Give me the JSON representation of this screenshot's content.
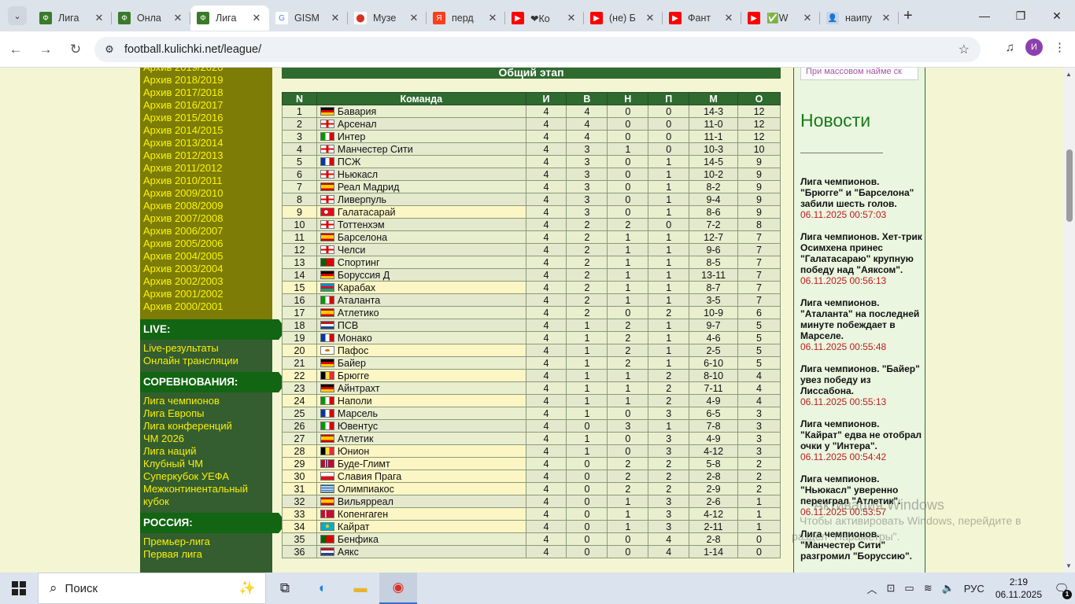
{
  "browser": {
    "tabs": [
      {
        "title": "Лига",
        "icon": "football-site-icon",
        "fav_bg": "#3a7a2a",
        "fav_char": "Ф"
      },
      {
        "title": "Онла",
        "icon": "football-site-icon",
        "fav_bg": "#3a7a2a",
        "fav_char": "Ф"
      },
      {
        "title": "Лига",
        "icon": "football-site-icon",
        "fav_bg": "#3a7a2a",
        "fav_char": "Ф",
        "active": true
      },
      {
        "title": "GISM",
        "icon": "google-icon",
        "fav_bg": "#ffffff",
        "fav_char": "G"
      },
      {
        "title": "Музе",
        "icon": "maps-pin-icon",
        "fav_bg": "#ffffff",
        "fav_char": "⬤"
      },
      {
        "title": "перд",
        "icon": "yandex-icon",
        "fav_bg": "#fc3f1d",
        "fav_char": "Я"
      },
      {
        "title": "❤Ко",
        "icon": "youtube-icon",
        "fav_bg": "#ff0000",
        "fav_char": "▶"
      },
      {
        "title": "(не) Б",
        "icon": "youtube-icon",
        "fav_bg": "#ff0000",
        "fav_char": "▶"
      },
      {
        "title": "Фант",
        "icon": "youtube-icon",
        "fav_bg": "#ff0000",
        "fav_char": "▶"
      },
      {
        "title": "✅W",
        "icon": "youtube-icon",
        "fav_bg": "#ff0000",
        "fav_char": "▶"
      },
      {
        "title": "наипу",
        "icon": "person-icon",
        "fav_bg": "#c8d4e8",
        "fav_char": "👤"
      }
    ],
    "url": "football.kulichki.net/league/",
    "avatar_letter": "И"
  },
  "sidebar": {
    "archive": [
      "Архив 2019/2020",
      "Архив 2018/2019",
      "Архив 2017/2018",
      "Архив 2016/2017",
      "Архив 2015/2016",
      "Архив 2014/2015",
      "Архив 2013/2014",
      "Архив 2012/2013",
      "Архив 2011/2012",
      "Архив 2010/2011",
      "Архив 2009/2010",
      "Архив 2008/2009",
      "Архив 2007/2008",
      "Архив 2006/2007",
      "Архив 2005/2006",
      "Архив 2004/2005",
      "Архив 2003/2004",
      "Архив 2002/2003",
      "Архив 2001/2002",
      "Архив 2000/2001"
    ],
    "live_title": "LIVE:",
    "live_links": [
      "Live-результаты",
      "Онлайн трансляции"
    ],
    "comp_title": "СОРЕВНОВАНИЯ:",
    "comp_links": [
      "Лига чемпионов",
      "Лига Европы",
      "Лига конференций",
      "ЧМ 2026",
      "Лига наций",
      "Клубный ЧМ",
      "Суперкубок УЕФА",
      "Межконтинентальный кубок"
    ],
    "russia_title": "РОССИЯ:",
    "russia_links": [
      "Премьер-лига",
      "Первая лига"
    ]
  },
  "standings": {
    "stage_title": "Общий этап",
    "headers": [
      "N",
      "Команда",
      "И",
      "В",
      "Н",
      "П",
      "М",
      "О"
    ],
    "rows": [
      {
        "n": "1",
        "team": "Бавария",
        "flag": "de",
        "p": "4",
        "w": "4",
        "d": "0",
        "l": "0",
        "goals": "14-3",
        "pts": "12"
      },
      {
        "n": "2",
        "team": "Арсенал",
        "flag": "en",
        "p": "4",
        "w": "4",
        "d": "0",
        "l": "0",
        "goals": "11-0",
        "pts": "12"
      },
      {
        "n": "3",
        "team": "Интер",
        "flag": "it",
        "p": "4",
        "w": "4",
        "d": "0",
        "l": "0",
        "goals": "11-1",
        "pts": "12"
      },
      {
        "n": "4",
        "team": "Манчестер Сити",
        "flag": "en",
        "p": "4",
        "w": "3",
        "d": "1",
        "l": "0",
        "goals": "10-3",
        "pts": "10"
      },
      {
        "n": "5",
        "team": "ПСЖ",
        "flag": "fr",
        "p": "4",
        "w": "3",
        "d": "0",
        "l": "1",
        "goals": "14-5",
        "pts": "9"
      },
      {
        "n": "6",
        "team": "Ньюкасл",
        "flag": "en",
        "p": "4",
        "w": "3",
        "d": "0",
        "l": "1",
        "goals": "10-2",
        "pts": "9"
      },
      {
        "n": "7",
        "team": "Реал Мадрид",
        "flag": "es",
        "p": "4",
        "w": "3",
        "d": "0",
        "l": "1",
        "goals": "8-2",
        "pts": "9"
      },
      {
        "n": "8",
        "team": "Ливерпуль",
        "flag": "en",
        "p": "4",
        "w": "3",
        "d": "0",
        "l": "1",
        "goals": "9-4",
        "pts": "9"
      },
      {
        "n": "9",
        "team": "Галатасарай",
        "flag": "tr",
        "p": "4",
        "w": "3",
        "d": "0",
        "l": "1",
        "goals": "8-6",
        "pts": "9",
        "hl": true
      },
      {
        "n": "10",
        "team": "Тоттенхэм",
        "flag": "en",
        "p": "4",
        "w": "2",
        "d": "2",
        "l": "0",
        "goals": "7-2",
        "pts": "8"
      },
      {
        "n": "11",
        "team": "Барселона",
        "flag": "es",
        "p": "4",
        "w": "2",
        "d": "1",
        "l": "1",
        "goals": "12-7",
        "pts": "7"
      },
      {
        "n": "12",
        "team": "Челси",
        "flag": "en",
        "p": "4",
        "w": "2",
        "d": "1",
        "l": "1",
        "goals": "9-6",
        "pts": "7"
      },
      {
        "n": "13",
        "team": "Спортинг",
        "flag": "pt",
        "p": "4",
        "w": "2",
        "d": "1",
        "l": "1",
        "goals": "8-5",
        "pts": "7"
      },
      {
        "n": "14",
        "team": "Боруссия Д",
        "flag": "de",
        "p": "4",
        "w": "2",
        "d": "1",
        "l": "1",
        "goals": "13-11",
        "pts": "7"
      },
      {
        "n": "15",
        "team": "Карабах",
        "flag": "az",
        "p": "4",
        "w": "2",
        "d": "1",
        "l": "1",
        "goals": "8-7",
        "pts": "7",
        "hl": true
      },
      {
        "n": "16",
        "team": "Аталанта",
        "flag": "it",
        "p": "4",
        "w": "2",
        "d": "1",
        "l": "1",
        "goals": "3-5",
        "pts": "7"
      },
      {
        "n": "17",
        "team": "Атлетико",
        "flag": "es",
        "p": "4",
        "w": "2",
        "d": "0",
        "l": "2",
        "goals": "10-9",
        "pts": "6"
      },
      {
        "n": "18",
        "team": "ПСВ",
        "flag": "nl",
        "p": "4",
        "w": "1",
        "d": "2",
        "l": "1",
        "goals": "9-7",
        "pts": "5"
      },
      {
        "n": "19",
        "team": "Монако",
        "flag": "fr",
        "p": "4",
        "w": "1",
        "d": "2",
        "l": "1",
        "goals": "4-6",
        "pts": "5"
      },
      {
        "n": "20",
        "team": "Пафос",
        "flag": "cy",
        "p": "4",
        "w": "1",
        "d": "2",
        "l": "1",
        "goals": "2-5",
        "pts": "5",
        "hl": true
      },
      {
        "n": "21",
        "team": "Байер",
        "flag": "de",
        "p": "4",
        "w": "1",
        "d": "2",
        "l": "1",
        "goals": "6-10",
        "pts": "5"
      },
      {
        "n": "22",
        "team": "Брюгге",
        "flag": "be",
        "p": "4",
        "w": "1",
        "d": "1",
        "l": "2",
        "goals": "8-10",
        "pts": "4",
        "hl": true
      },
      {
        "n": "23",
        "team": "Айнтрахт",
        "flag": "de",
        "p": "4",
        "w": "1",
        "d": "1",
        "l": "2",
        "goals": "7-11",
        "pts": "4"
      },
      {
        "n": "24",
        "team": "Наполи",
        "flag": "it",
        "p": "4",
        "w": "1",
        "d": "1",
        "l": "2",
        "goals": "4-9",
        "pts": "4",
        "hl": true
      },
      {
        "n": "25",
        "team": "Марсель",
        "flag": "fr",
        "p": "4",
        "w": "1",
        "d": "0",
        "l": "3",
        "goals": "6-5",
        "pts": "3"
      },
      {
        "n": "26",
        "team": "Ювентус",
        "flag": "it",
        "p": "4",
        "w": "0",
        "d": "3",
        "l": "1",
        "goals": "7-8",
        "pts": "3"
      },
      {
        "n": "27",
        "team": "Атлетик",
        "flag": "es",
        "p": "4",
        "w": "1",
        "d": "0",
        "l": "3",
        "goals": "4-9",
        "pts": "3"
      },
      {
        "n": "28",
        "team": "Юнион",
        "flag": "be",
        "p": "4",
        "w": "1",
        "d": "0",
        "l": "3",
        "goals": "4-12",
        "pts": "3",
        "hl": true
      },
      {
        "n": "29",
        "team": "Буде-Глимт",
        "flag": "no",
        "p": "4",
        "w": "0",
        "d": "2",
        "l": "2",
        "goals": "5-8",
        "pts": "2",
        "hl": true
      },
      {
        "n": "30",
        "team": "Славия Прага",
        "flag": "cz",
        "p": "4",
        "w": "0",
        "d": "2",
        "l": "2",
        "goals": "2-8",
        "pts": "2",
        "hl": true
      },
      {
        "n": "31",
        "team": "Олимпиакос",
        "flag": "gr",
        "p": "4",
        "w": "0",
        "d": "2",
        "l": "2",
        "goals": "2-9",
        "pts": "2",
        "hl": true
      },
      {
        "n": "32",
        "team": "Вильярреал",
        "flag": "es",
        "p": "4",
        "w": "0",
        "d": "1",
        "l": "3",
        "goals": "2-6",
        "pts": "1"
      },
      {
        "n": "33",
        "team": "Копенгаген",
        "flag": "dk",
        "p": "4",
        "w": "0",
        "d": "1",
        "l": "3",
        "goals": "4-12",
        "pts": "1",
        "hl": true
      },
      {
        "n": "34",
        "team": "Кайрат",
        "flag": "kz",
        "p": "4",
        "w": "0",
        "d": "1",
        "l": "3",
        "goals": "2-11",
        "pts": "1",
        "hl": true
      },
      {
        "n": "35",
        "team": "Бенфика",
        "flag": "pt",
        "p": "4",
        "w": "0",
        "d": "0",
        "l": "4",
        "goals": "2-8",
        "pts": "0"
      },
      {
        "n": "36",
        "team": "Аякс",
        "flag": "nl",
        "p": "4",
        "w": "0",
        "d": "0",
        "l": "4",
        "goals": "1-14",
        "pts": "0"
      }
    ]
  },
  "news": {
    "ad_text": "При массовом найме ск",
    "title": "Новости",
    "items": [
      {
        "title": "Лига чемпионов. \"Брюгге\" и \"Барселона\" забили шесть голов.",
        "time": "06.11.2025 00:57:03"
      },
      {
        "title": "Лига чемпионов. Хет-трик Осимхена принес \"Галатасараю\" крупную победу над \"Аяксом\".",
        "time": "06.11.2025 00:56:13"
      },
      {
        "title": "Лига чемпионов. \"Аталанта\" на последней минуте побеждает в Марселе.",
        "time": "06.11.2025 00:55:48"
      },
      {
        "title": "Лига чемпионов. \"Байер\" увез победу из Лиссабона.",
        "time": "06.11.2025 00:55:13"
      },
      {
        "title": "Лига чемпионов. \"Кайрат\" едва не отобрал очки у \"Интера\".",
        "time": "06.11.2025 00:54:42"
      },
      {
        "title": "Лига чемпионов. \"Ньюкасл\" уверенно переиграл \"Атлетик\".",
        "time": "06.11.2025 00:53:57"
      },
      {
        "title": "Лига чемпионов. \"Манчестер Сити\" разгромил \"Боруссию\".",
        "time": ""
      }
    ]
  },
  "watermark": {
    "line1": "Активация Windows",
    "line2": "Чтобы активировать Windows, перейдите в",
    "line3": "раздел \"Параметры\"."
  },
  "taskbar": {
    "search_text": "Поиск",
    "lang": "РУС",
    "time": "2:19",
    "date": "06.11.2025",
    "notif_count": "1"
  },
  "colors": {
    "accent_green": "#2f6a2f",
    "link_yellow": "#fbef00",
    "news_time_red": "#c01d1d"
  }
}
